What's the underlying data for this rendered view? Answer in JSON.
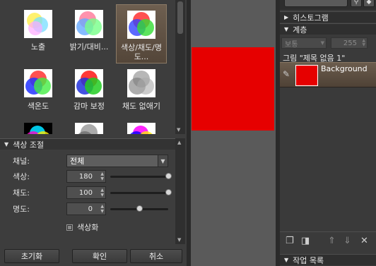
{
  "adjustments": [
    {
      "label": "노출"
    },
    {
      "label": "밝기/대비..."
    },
    {
      "label": "색상/채도/명도..."
    },
    {
      "label": "색온도"
    },
    {
      "label": "감마 보정"
    },
    {
      "label": "채도 없애기"
    },
    {
      "label": ""
    },
    {
      "label": ""
    },
    {
      "label": ""
    }
  ],
  "selected_adjustment": "색상/채도/명도...",
  "hue_sat_panel": {
    "title": "색상 조절",
    "channel_label": "채널:",
    "channel_value": "전체",
    "hue_label": "색상:",
    "hue_value": "180",
    "hue_level": 1.0,
    "saturation_label": "채도:",
    "saturation_value": "100",
    "saturation_level": 1.0,
    "lightness_label": "명도:",
    "lightness_value": "0",
    "lightness_level": 0.5,
    "colorize_label": "색상화"
  },
  "buttons": {
    "reset": "초기화",
    "ok": "확인",
    "cancel": "취소"
  },
  "right_panel": {
    "histogram_title": "히스토그램",
    "layers_title": "계층",
    "blend_mode": "보통",
    "opacity": "255",
    "document_title": "그림 \"제목 없음 1\"",
    "layer_name": "Background",
    "jobs_title": "작업 목록"
  },
  "colors": {
    "canvas": "#e60000",
    "selection": "#6e5f50"
  }
}
